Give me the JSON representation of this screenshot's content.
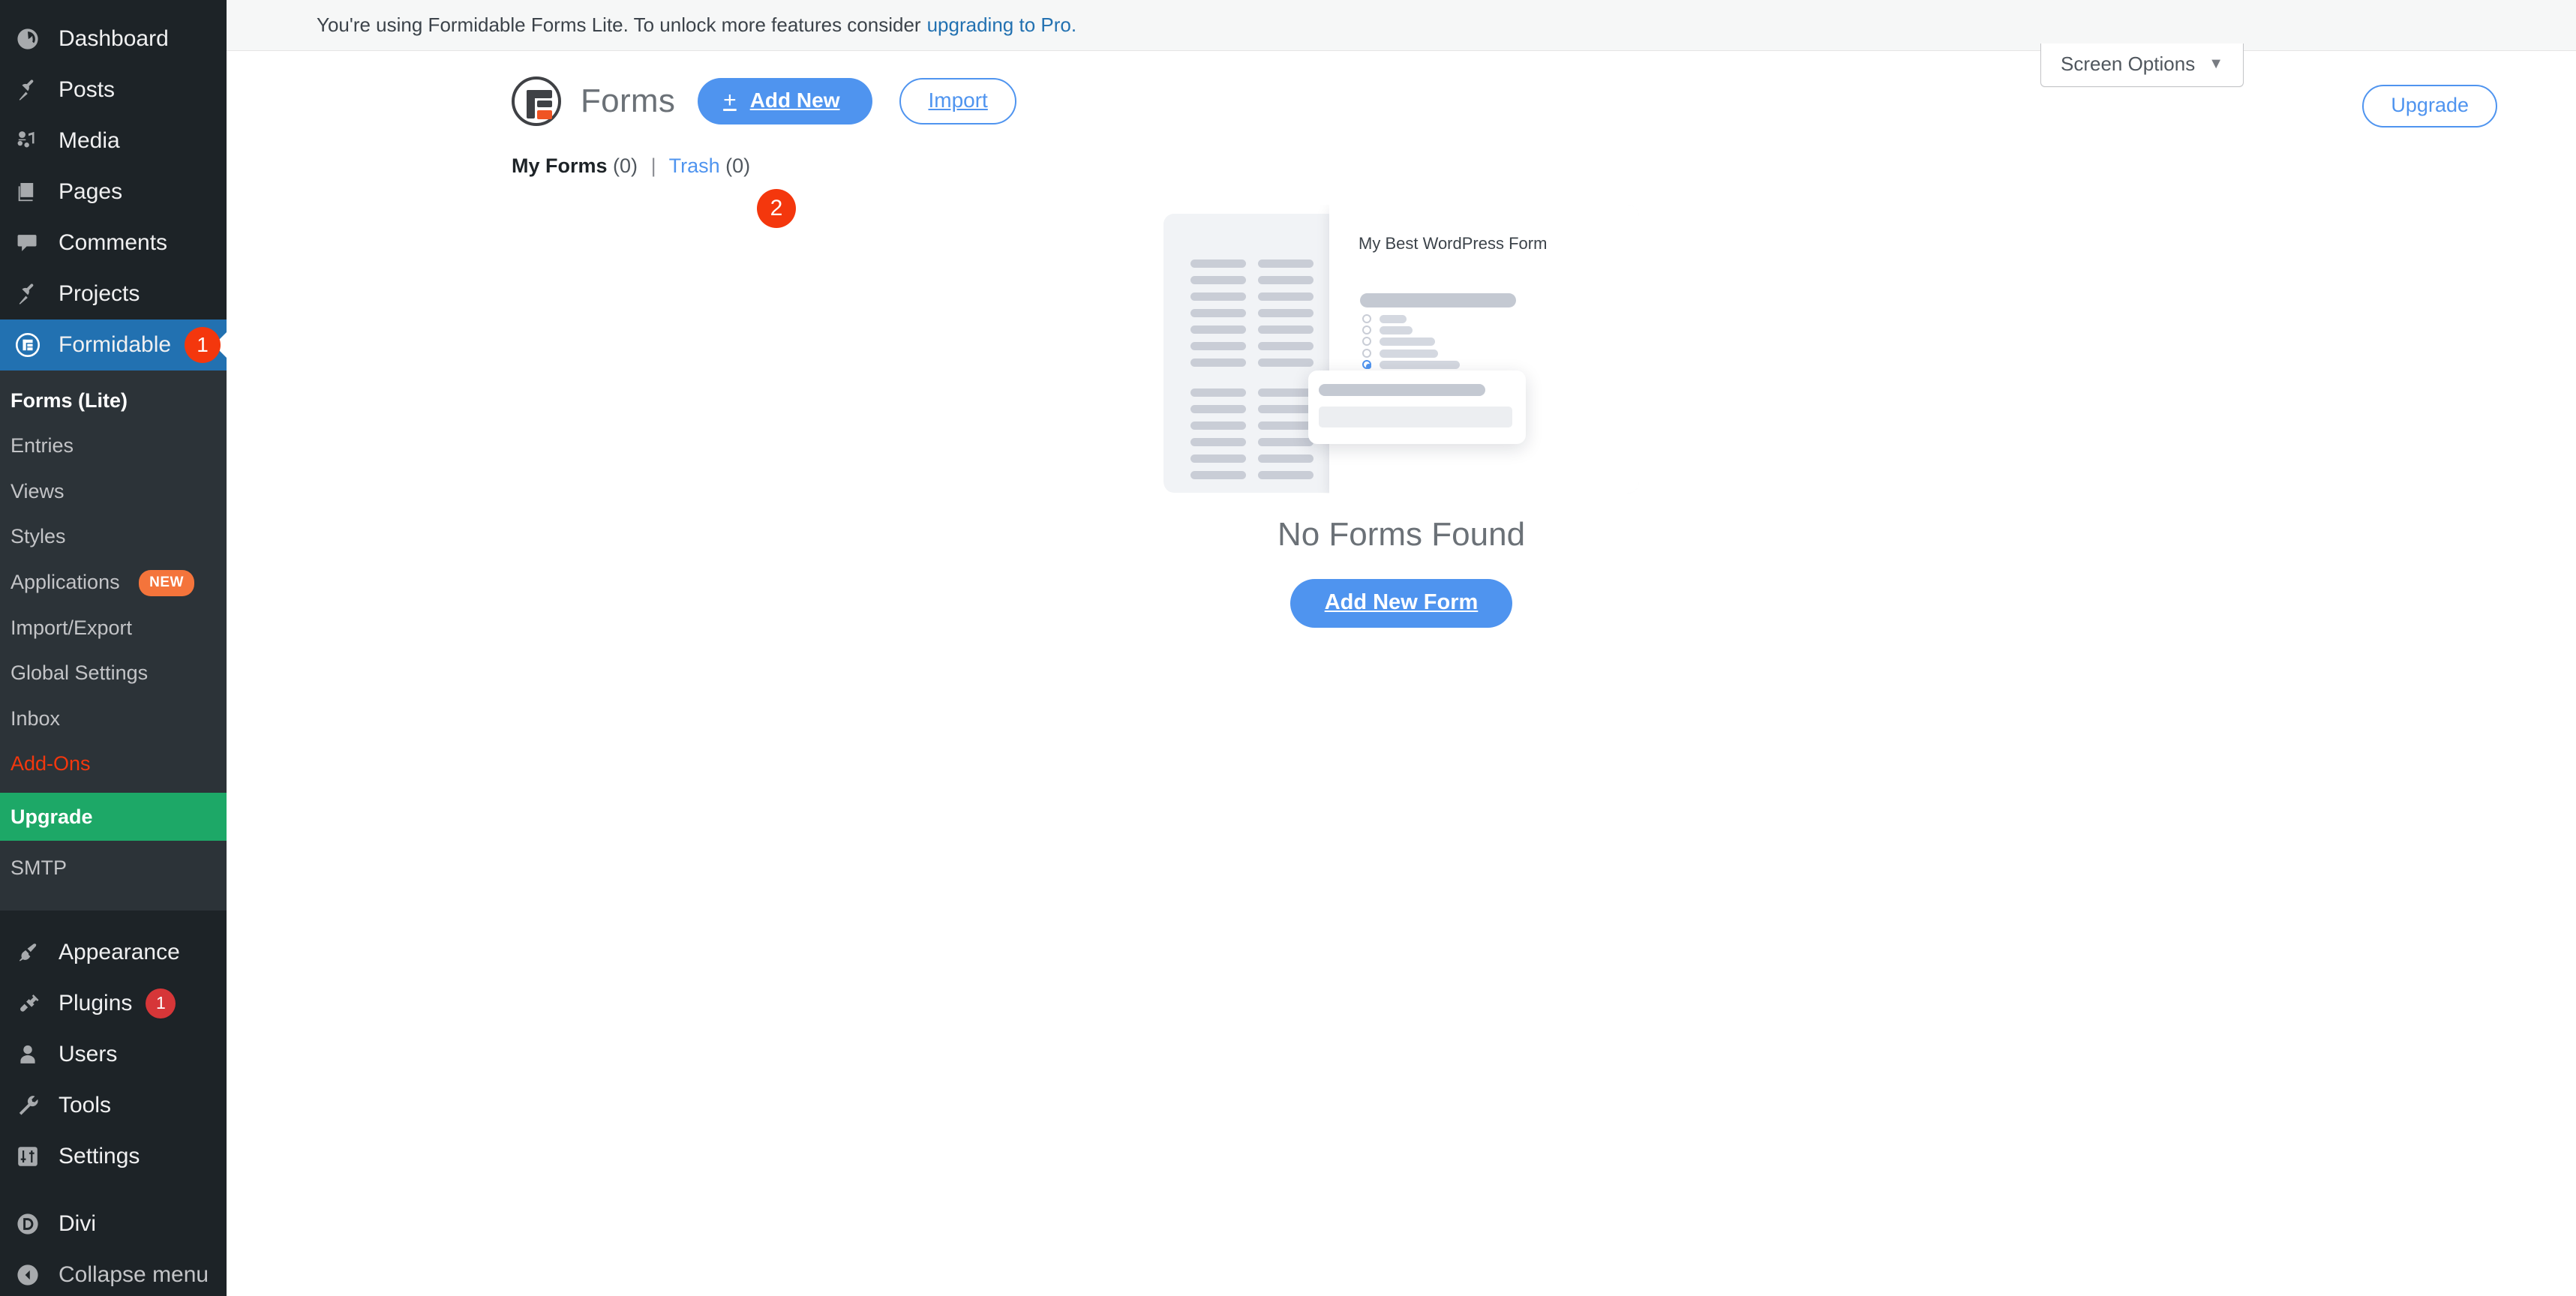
{
  "notice": {
    "text": "You're using Formidable Forms Lite. To unlock more features consider",
    "link_text": "upgrading to Pro."
  },
  "screen_options": {
    "label": "Screen Options",
    "caret": "▼"
  },
  "header": {
    "upgrade_label": "Upgrade",
    "logo_icon": "formidable-logo-icon",
    "page_title": "Forms",
    "add_new_label": "Add New",
    "add_new_plus": "+",
    "import_label": "Import"
  },
  "markers": {
    "one": "1",
    "two": "2"
  },
  "filters": {
    "my_forms_label": "My Forms",
    "my_forms_count": "(0)",
    "separator": "|",
    "trash_label": "Trash",
    "trash_count": "(0)"
  },
  "empty_state": {
    "illustration_form_title": "My Best WordPress Form",
    "heading": "No Forms Found",
    "button_label": "Add New Form"
  },
  "sidebar": {
    "items": [
      {
        "label": "Dashboard",
        "icon": "dashboard-icon"
      },
      {
        "label": "Posts",
        "icon": "pin-icon"
      },
      {
        "label": "Media",
        "icon": "media-icon"
      },
      {
        "label": "Pages",
        "icon": "pages-icon"
      },
      {
        "label": "Comments",
        "icon": "comment-icon"
      },
      {
        "label": "Projects",
        "icon": "pin-icon"
      },
      {
        "label": "Formidable",
        "icon": "formidable-icon",
        "badge": "1"
      },
      {
        "label": "Appearance",
        "icon": "brush-icon"
      },
      {
        "label": "Plugins",
        "icon": "plug-icon",
        "badge": "1"
      },
      {
        "label": "Users",
        "icon": "user-icon"
      },
      {
        "label": "Tools",
        "icon": "wrench-icon"
      },
      {
        "label": "Settings",
        "icon": "sliders-icon"
      },
      {
        "label": "Divi",
        "icon": "divi-icon"
      },
      {
        "label": "Collapse menu",
        "icon": "collapse-arrow-icon"
      }
    ],
    "submenu": [
      {
        "label": "Forms (Lite)"
      },
      {
        "label": "Entries"
      },
      {
        "label": "Views"
      },
      {
        "label": "Styles"
      },
      {
        "label": "Applications",
        "badge": "NEW"
      },
      {
        "label": "Import/Export"
      },
      {
        "label": "Global Settings"
      },
      {
        "label": "Inbox"
      },
      {
        "label": "Add-Ons"
      },
      {
        "label": "Upgrade"
      },
      {
        "label": "SMTP"
      }
    ]
  },
  "colors": {
    "sidebar_bg": "#1d2327",
    "submenu_bg": "#2c3338",
    "active_blue": "#2271b1",
    "accent_blue": "#4f94ef",
    "marker_orange": "#f4370d",
    "upgrade_green": "#1da867",
    "addons_orange": "#f4370d",
    "new_badge_orange": "#f4743b",
    "plugins_red": "#d63638",
    "logo_orange": "#f05423"
  }
}
